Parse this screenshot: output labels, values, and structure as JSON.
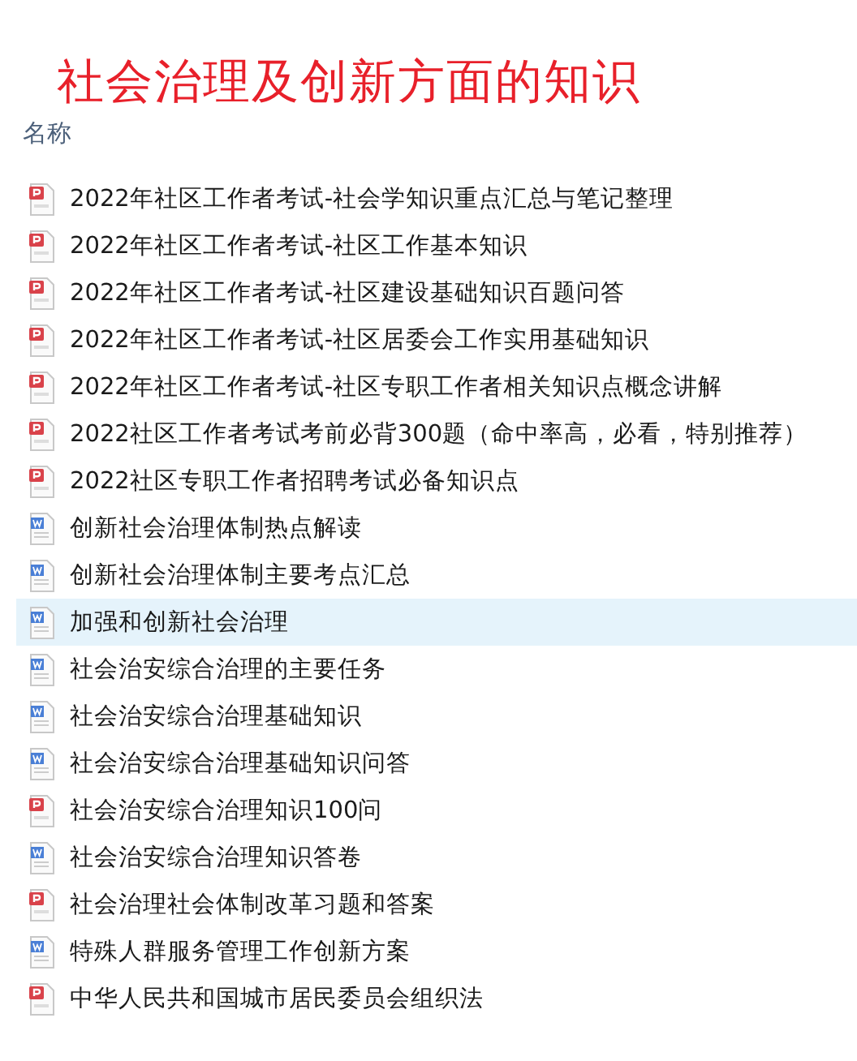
{
  "title": "社会治理及创新方面的知识",
  "column_header": "名称",
  "files": [
    {
      "name": "2022年社区工作者考试-社会学知识重点汇总与笔记整理",
      "kind": "pdf",
      "selected": false
    },
    {
      "name": "2022年社区工作者考试-社区工作基本知识",
      "kind": "pdf",
      "selected": false
    },
    {
      "name": "2022年社区工作者考试-社区建设基础知识百题问答",
      "kind": "pdf",
      "selected": false
    },
    {
      "name": "2022年社区工作者考试-社区居委会工作实用基础知识",
      "kind": "pdf",
      "selected": false
    },
    {
      "name": "2022年社区工作者考试-社区专职工作者相关知识点概念讲解",
      "kind": "pdf",
      "selected": false
    },
    {
      "name": "2022社区工作者考试考前必背300题（命中率高，必看，特别推荐）",
      "kind": "pdf",
      "selected": false
    },
    {
      "name": "2022社区专职工作者招聘考试必备知识点",
      "kind": "pdf",
      "selected": false
    },
    {
      "name": "创新社会治理体制热点解读",
      "kind": "doc",
      "selected": false
    },
    {
      "name": "创新社会治理体制主要考点汇总",
      "kind": "doc",
      "selected": false
    },
    {
      "name": "加强和创新社会治理",
      "kind": "doc",
      "selected": true
    },
    {
      "name": "社会治安综合治理的主要任务",
      "kind": "doc",
      "selected": false
    },
    {
      "name": "社会治安综合治理基础知识",
      "kind": "doc",
      "selected": false
    },
    {
      "name": "社会治安综合治理基础知识问答",
      "kind": "doc",
      "selected": false
    },
    {
      "name": "社会治安综合治理知识100问",
      "kind": "pdf",
      "selected": false
    },
    {
      "name": "社会治安综合治理知识答卷",
      "kind": "doc",
      "selected": false
    },
    {
      "name": "社会治理社会体制改革习题和答案",
      "kind": "pdf",
      "selected": false
    },
    {
      "name": "特殊人群服务管理工作创新方案",
      "kind": "doc",
      "selected": false
    },
    {
      "name": "中华人民共和国城市居民委员会组织法",
      "kind": "pdf",
      "selected": false
    }
  ]
}
